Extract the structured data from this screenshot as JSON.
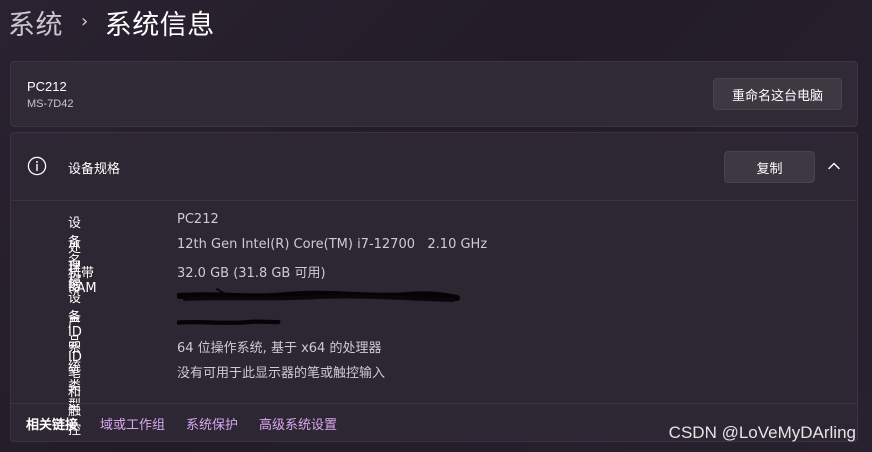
{
  "breadcrumb": {
    "parent": "系统",
    "separator": "›",
    "current": "系统信息"
  },
  "device_card": {
    "name": "PC212",
    "model": "MS-7D42",
    "rename_button": "重命名这台电脑"
  },
  "spec_section": {
    "icon": "info-icon",
    "title": "设备规格",
    "copy_button": "复制",
    "collapse_icon": "chevron-up-icon",
    "rows": [
      {
        "key": "设备名称",
        "value": "PC212"
      },
      {
        "key": "处理器",
        "value": "12th Gen Intel(R) Core(TM) i7-12700   2.10 GHz"
      },
      {
        "key": "机带 RAM",
        "value": "32.0 GB (31.8 GB 可用)"
      },
      {
        "key": "设备 ID",
        "value": ""
      },
      {
        "key": "产品 ID",
        "value": ""
      },
      {
        "key": "系统类型",
        "value": "64 位操作系统, 基于 x64 的处理器"
      },
      {
        "key": "笔和触控",
        "value": "没有可用于此显示器的笔或触控输入"
      }
    ]
  },
  "related": {
    "label": "相关链接",
    "links": [
      "域或工作组",
      "系统保护",
      "高级系统设置"
    ]
  },
  "watermark": "CSDN @LoVeMyDArling",
  "colors": {
    "background": "#251e2a",
    "card": "#2f2a35",
    "link": "#d8a8f2",
    "text_secondary": "#cfcbd3"
  }
}
